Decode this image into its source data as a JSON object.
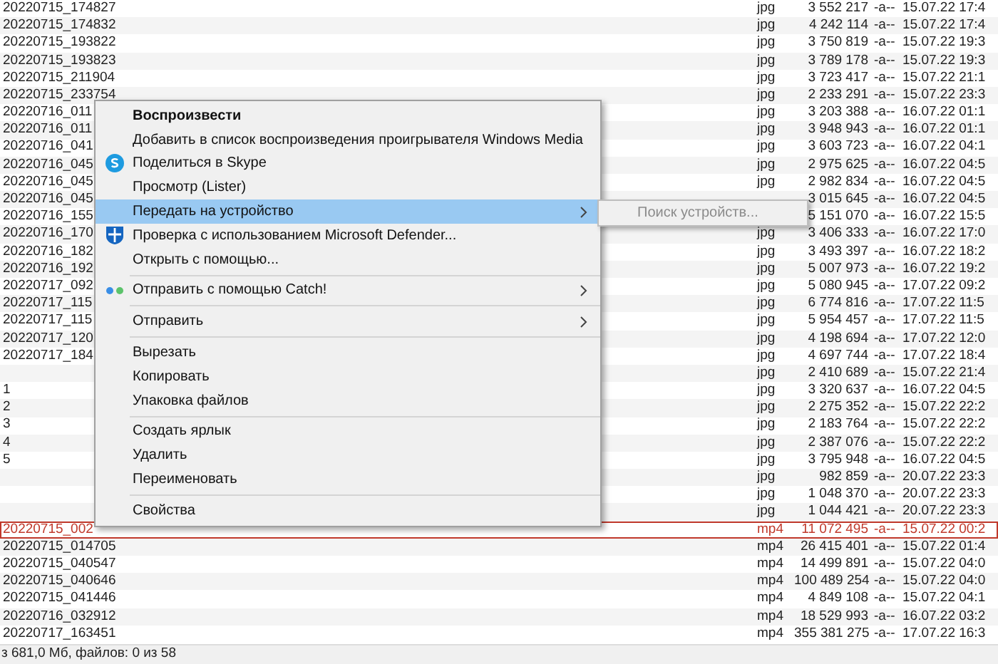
{
  "files": [
    {
      "name": "20220715_174827",
      "ext": "jpg",
      "size": "3 552 217",
      "attr": "-a--",
      "date": "15.07.22 17:4",
      "selected": false
    },
    {
      "name": "20220715_174832",
      "ext": "jpg",
      "size": "4 242 114",
      "attr": "-a--",
      "date": "15.07.22 17:4",
      "selected": false
    },
    {
      "name": "20220715_193822",
      "ext": "jpg",
      "size": "3 750 819",
      "attr": "-a--",
      "date": "15.07.22 19:3",
      "selected": false
    },
    {
      "name": "20220715_193823",
      "ext": "jpg",
      "size": "3 789 178",
      "attr": "-a--",
      "date": "15.07.22 19:3",
      "selected": false
    },
    {
      "name": "20220715_211904",
      "ext": "jpg",
      "size": "3 723 417",
      "attr": "-a--",
      "date": "15.07.22 21:1",
      "selected": false
    },
    {
      "name": "20220715_233754",
      "ext": "jpg",
      "size": "2 233 291",
      "attr": "-a--",
      "date": "15.07.22 23:3",
      "selected": false
    },
    {
      "name": "20220716_011",
      "ext": "jpg",
      "size": "3 203 388",
      "attr": "-a--",
      "date": "16.07.22 01:1",
      "selected": false
    },
    {
      "name": "20220716_011",
      "ext": "jpg",
      "size": "3 948 943",
      "attr": "-a--",
      "date": "16.07.22 01:1",
      "selected": false
    },
    {
      "name": "20220716_041",
      "ext": "jpg",
      "size": "3 603 723",
      "attr": "-a--",
      "date": "16.07.22 04:1",
      "selected": false
    },
    {
      "name": "20220716_045",
      "ext": "jpg",
      "size": "2 975 625",
      "attr": "-a--",
      "date": "16.07.22 04:5",
      "selected": false
    },
    {
      "name": "20220716_045",
      "ext": "jpg",
      "size": "2 982 834",
      "attr": "-a--",
      "date": "16.07.22 04:5",
      "selected": false
    },
    {
      "name": "20220716_045",
      "size": "3 015 645",
      "attr": "-a--",
      "date": "16.07.22 04:5",
      "selected": false
    },
    {
      "name": "20220716_155",
      "size": "5 151 070",
      "attr": "-a--",
      "date": "16.07.22 15:5",
      "selected": false
    },
    {
      "name": "20220716_170",
      "ext": "jpg",
      "size": "3 406 333",
      "attr": "-a--",
      "date": "16.07.22 17:0",
      "selected": false
    },
    {
      "name": "20220716_182",
      "ext": "jpg",
      "size": "3 493 397",
      "attr": "-a--",
      "date": "16.07.22 18:2",
      "selected": false
    },
    {
      "name": "20220716_192",
      "ext": "jpg",
      "size": "5 007 973",
      "attr": "-a--",
      "date": "16.07.22 19:2",
      "selected": false
    },
    {
      "name": "20220717_092",
      "ext": "jpg",
      "size": "5 080 945",
      "attr": "-a--",
      "date": "17.07.22 09:2",
      "selected": false
    },
    {
      "name": "20220717_115",
      "ext": "jpg",
      "size": "6 774 816",
      "attr": "-a--",
      "date": "17.07.22 11:5",
      "selected": false
    },
    {
      "name": "20220717_115",
      "ext": "jpg",
      "size": "5 954 457",
      "attr": "-a--",
      "date": "17.07.22 11:5",
      "selected": false
    },
    {
      "name": "20220717_120",
      "ext": "jpg",
      "size": "4 198 694",
      "attr": "-a--",
      "date": "17.07.22 12:0",
      "selected": false
    },
    {
      "name": "20220717_184",
      "ext": "jpg",
      "size": "4 697 744",
      "attr": "-a--",
      "date": "17.07.22 18:4",
      "selected": false
    },
    {
      "ext": "jpg",
      "size": "2 410 689",
      "attr": "-a--",
      "date": "15.07.22 21:4",
      "selected": false
    },
    {
      "name": "1",
      "ext": "jpg",
      "size": "3 320 637",
      "attr": "-a--",
      "date": "16.07.22 04:5",
      "selected": false
    },
    {
      "name": "2",
      "ext": "jpg",
      "size": "2 275 352",
      "attr": "-a--",
      "date": "15.07.22 22:2",
      "selected": false
    },
    {
      "name": "3",
      "ext": "jpg",
      "size": "2 183 764",
      "attr": "-a--",
      "date": "15.07.22 22:2",
      "selected": false
    },
    {
      "name": "4",
      "ext": "jpg",
      "size": "2 387 076",
      "attr": "-a--",
      "date": "15.07.22 22:2",
      "selected": false
    },
    {
      "name": "5",
      "ext": "jpg",
      "size": "3 795 948",
      "attr": "-a--",
      "date": "16.07.22 04:5",
      "selected": false
    },
    {
      "ext": "jpg",
      "size": "982 859",
      "attr": "-a--",
      "date": "20.07.22 23:3",
      "selected": false
    },
    {
      "ext": "jpg",
      "size": "1 048 370",
      "attr": "-a--",
      "date": "20.07.22 23:3",
      "selected": false
    },
    {
      "ext": "jpg",
      "size": "1 044 421",
      "attr": "-a--",
      "date": "20.07.22 23:3",
      "selected": false
    },
    {
      "name": "20220715_002",
      "ext": "mp4",
      "size": "11 072 495",
      "attr": "-a--",
      "date": "15.07.22 00:2",
      "selected": true
    },
    {
      "name": "20220715_014705",
      "ext": "mp4",
      "size": "26 415 401",
      "attr": "-a--",
      "date": "15.07.22 01:4",
      "selected": false
    },
    {
      "name": "20220715_040547",
      "ext": "mp4",
      "size": "14 499 891",
      "attr": "-a--",
      "date": "15.07.22 04:0",
      "selected": false
    },
    {
      "name": "20220715_040646",
      "ext": "mp4",
      "size": "100 489 254",
      "attr": "-a--",
      "date": "15.07.22 04:0",
      "selected": false
    },
    {
      "name": "20220715_041446",
      "ext": "mp4",
      "size": "4 849 108",
      "attr": "-a--",
      "date": "15.07.22 04:1",
      "selected": false
    },
    {
      "name": "20220716_032912",
      "ext": "mp4",
      "size": "18 529 993",
      "attr": "-a--",
      "date": "16.07.22 03:2",
      "selected": false
    },
    {
      "name": "20220717_163451",
      "ext": "mp4",
      "size": "355 381 275",
      "attr": "-a--",
      "date": "17.07.22 16:3",
      "selected": false
    }
  ],
  "status_bar": "з 681,0 Мб, файлов: 0 из 58",
  "context_menu": [
    {
      "kind": "item",
      "label": "Воспроизвести",
      "bold": true,
      "selected": false
    },
    {
      "kind": "item",
      "label": "Добавить в список воспроизведения проигрывателя Windows Media",
      "selected": false
    },
    {
      "kind": "skype",
      "label": "Поделиться в Skype",
      "selected": false
    },
    {
      "kind": "item",
      "label": "Просмотр (Lister)",
      "selected": false
    },
    {
      "kind": "item",
      "label": "Передать на устройство",
      "submenu": true,
      "selected": true
    },
    {
      "kind": "shield",
      "label": "Проверка с использованием Microsoft Defender...",
      "selected": false
    },
    {
      "kind": "item",
      "label": "Открыть с помощью...",
      "selected": false
    },
    {
      "kind": "separator"
    },
    {
      "kind": "catch",
      "label": "Отправить с помощью Catch!",
      "submenu": true,
      "selected": false
    },
    {
      "kind": "separator"
    },
    {
      "kind": "item",
      "label": "Отправить",
      "submenu": true,
      "selected": false
    },
    {
      "kind": "separator"
    },
    {
      "kind": "item",
      "label": "Вырезать",
      "selected": false
    },
    {
      "kind": "item",
      "label": "Копировать",
      "selected": false
    },
    {
      "kind": "item",
      "label": "Упаковка файлов",
      "selected": false
    },
    {
      "kind": "separator"
    },
    {
      "kind": "item",
      "label": "Создать ярлык",
      "selected": false
    },
    {
      "kind": "item",
      "label": "Удалить",
      "selected": false
    },
    {
      "kind": "item",
      "label": "Переименовать",
      "selected": false
    },
    {
      "kind": "separator"
    },
    {
      "kind": "item",
      "label": "Свойства",
      "selected": false
    }
  ],
  "submenu": [
    {
      "label": "Поиск устройств...",
      "disabled": true
    }
  ]
}
